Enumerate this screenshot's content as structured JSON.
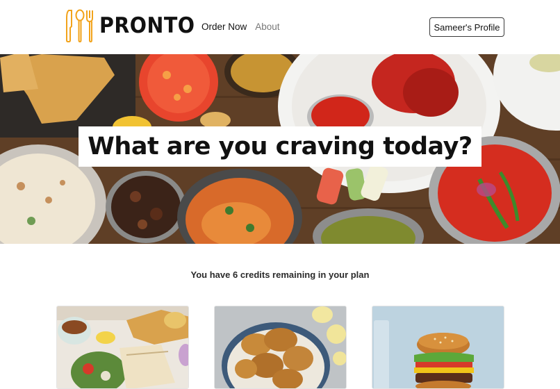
{
  "app": {
    "logo_text": "PRONTO",
    "logo_icon": "utensils-icon"
  },
  "nav": {
    "items": [
      {
        "label": "Order Now",
        "state": "active"
      },
      {
        "label": "About",
        "state": "muted"
      }
    ]
  },
  "profile": {
    "button_label": "Sameer's Profile"
  },
  "hero": {
    "title": "What are you craving today?"
  },
  "credits": {
    "message": "You have 6 credits remaining in your plan"
  },
  "cards": [
    {
      "image": "mediterranean-platter-image"
    },
    {
      "image": "fried-chicken-image"
    },
    {
      "image": "burger-image"
    }
  ],
  "colors": {
    "accent_orange": "#f2a31b",
    "text_dark": "#111111",
    "nav_muted": "#777777"
  }
}
